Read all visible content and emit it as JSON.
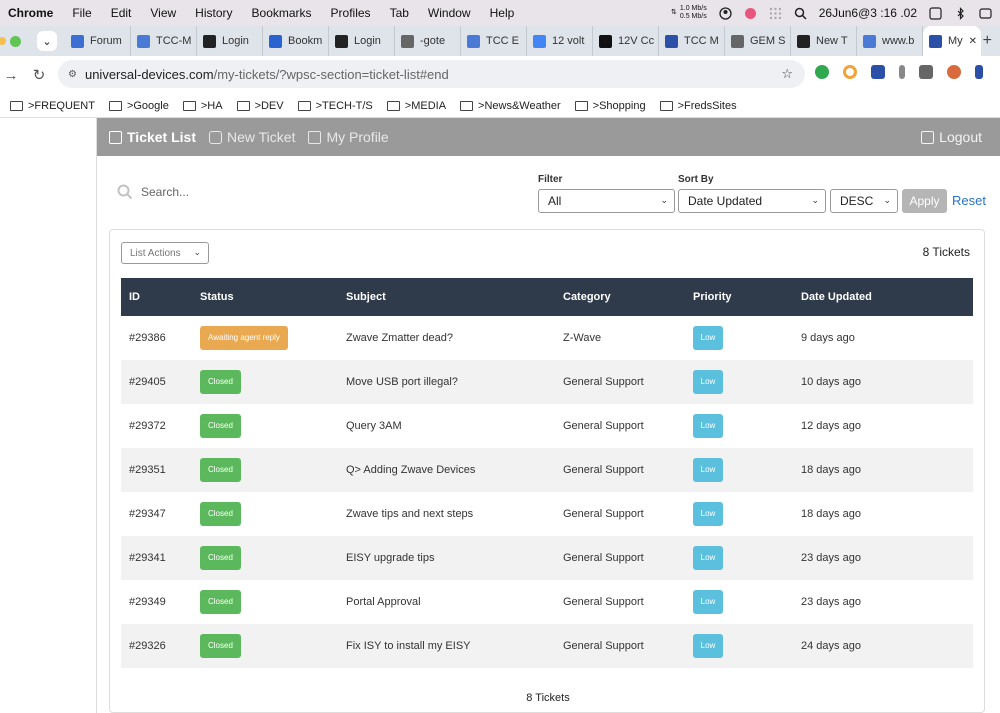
{
  "menubar": {
    "app": "Chrome",
    "items": [
      "File",
      "Edit",
      "View",
      "History",
      "Bookmarks",
      "Profiles",
      "Tab",
      "Window",
      "Help"
    ],
    "net_up": "1.0 Mb/s",
    "net_down": "0.5 Mb/s",
    "clock": "26Jun6@3 :16 .02"
  },
  "tabs": [
    {
      "label": "Forum",
      "icon": "forum-icon",
      "color": "#3b6fd1"
    },
    {
      "label": "TCC-M",
      "icon": "chart-icon",
      "color": "#4a7ad6"
    },
    {
      "label": "Login",
      "icon": "login-icon",
      "color": "#222222"
    },
    {
      "label": "Bookm",
      "icon": "star-icon",
      "color": "#2b62d1"
    },
    {
      "label": "Login",
      "icon": "login-icon",
      "color": "#222222"
    },
    {
      "label": "-gote",
      "icon": "globe-icon",
      "color": "#666666"
    },
    {
      "label": "TCC E",
      "icon": "chart-icon",
      "color": "#4a7ad6"
    },
    {
      "label": "12 volt",
      "icon": "google-icon",
      "color": "#4285f4"
    },
    {
      "label": "12V Cc",
      "icon": "amazon-icon",
      "color": "#111111"
    },
    {
      "label": "TCC M",
      "icon": "u-icon",
      "color": "#2c4fa8"
    },
    {
      "label": "GEM S",
      "icon": "globe-icon",
      "color": "#666666"
    },
    {
      "label": "New T",
      "icon": "github-icon",
      "color": "#222222"
    },
    {
      "label": "www.b",
      "icon": "pen-icon",
      "color": "#4a7ad6"
    },
    {
      "label": "My",
      "icon": "u-icon",
      "color": "#2c4fa8"
    }
  ],
  "address": {
    "host": "universal-devices.com",
    "path": "/my-tickets/?wpsc-section=ticket-list#end"
  },
  "bookmarks": [
    ">FREQUENT",
    ">Google",
    ">HA",
    ">DEV",
    ">TECH-T/S",
    ">MEDIA",
    ">News&Weather",
    ">Shopping",
    ">FredsSites"
  ],
  "topnav": {
    "ticket_list": "Ticket List",
    "new_ticket": "New Ticket",
    "my_profile": "My Profile",
    "logout": "Logout"
  },
  "filters": {
    "search_placeholder": "Search...",
    "filter_label": "Filter",
    "filter_value": "All",
    "sort_label": "Sort By",
    "sort_value": "Date Updated",
    "order_value": "DESC",
    "apply": "Apply",
    "reset": "Reset"
  },
  "list": {
    "actions_label": "List Actions",
    "count_top": "8 Tickets",
    "count_bottom": "8 Tickets",
    "columns": [
      "ID",
      "Status",
      "Subject",
      "Category",
      "Priority",
      "Date Updated"
    ],
    "rows": [
      {
        "id": "#29386",
        "status": "Awaiting agent reply",
        "status_color": "#e8a951",
        "subject": "Zwave Zmatter dead?",
        "category": "Z-Wave",
        "priority": "Low",
        "updated": "9 days ago"
      },
      {
        "id": "#29405",
        "status": "Closed",
        "status_color": "#5cb85c",
        "subject": "Move USB port illegal?",
        "category": "General Support",
        "priority": "Low",
        "updated": "10 days ago"
      },
      {
        "id": "#29372",
        "status": "Closed",
        "status_color": "#5cb85c",
        "subject": "Query 3AM",
        "category": "General Support",
        "priority": "Low",
        "updated": "12 days ago"
      },
      {
        "id": "#29351",
        "status": "Closed",
        "status_color": "#5cb85c",
        "subject": "Q> Adding Zwave Devices",
        "category": "General Support",
        "priority": "Low",
        "updated": "18 days ago"
      },
      {
        "id": "#29347",
        "status": "Closed",
        "status_color": "#5cb85c",
        "subject": "Zwave tips and next steps",
        "category": "General Support",
        "priority": "Low",
        "updated": "18 days ago"
      },
      {
        "id": "#29341",
        "status": "Closed",
        "status_color": "#5cb85c",
        "subject": "EISY upgrade tips",
        "category": "General Support",
        "priority": "Low",
        "updated": "23 days ago"
      },
      {
        "id": "#29349",
        "status": "Closed",
        "status_color": "#5cb85c",
        "subject": "Portal Approval",
        "category": "General Support",
        "priority": "Low",
        "updated": "23 days ago"
      },
      {
        "id": "#29326",
        "status": "Closed",
        "status_color": "#5cb85c",
        "subject": "Fix ISY to install my EISY",
        "category": "General Support",
        "priority": "Low",
        "updated": "24 days ago"
      }
    ],
    "priority_color": "#5bc0de"
  }
}
